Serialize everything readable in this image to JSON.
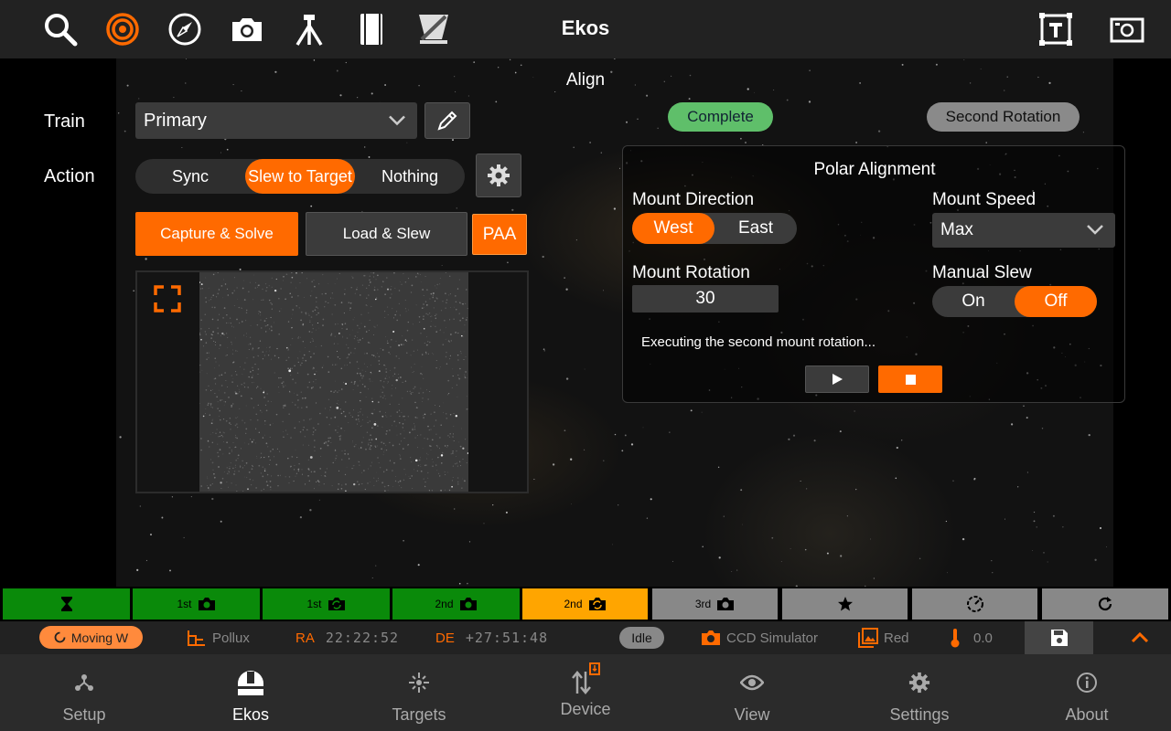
{
  "app": {
    "title": "Ekos"
  },
  "toolbar": {
    "icons": [
      "search-icon",
      "target-icon",
      "compass-icon",
      "camera-icon",
      "tripod-icon",
      "catalog-icon",
      "telescope-icon",
      "text-frame-icon",
      "screen-icon"
    ]
  },
  "align": {
    "section_title": "Align",
    "train_label": "Train",
    "train_value": "Primary",
    "action_label": "Action",
    "actions": [
      "Sync",
      "Slew to Target",
      "Nothing"
    ],
    "active_action": "Slew to Target",
    "capture_solve": "Capture & Solve",
    "load_slew": "Load & Slew",
    "paa": "PAA"
  },
  "polar": {
    "state_pill": "Complete",
    "stage_pill": "Second Rotation",
    "title": "Polar Alignment",
    "mount_direction_label": "Mount Direction",
    "directions": [
      "West",
      "East"
    ],
    "active_direction": "West",
    "mount_speed_label": "Mount Speed",
    "mount_speed_value": "Max",
    "mount_rotation_label": "Mount Rotation",
    "mount_rotation_value": "30",
    "manual_slew_label": "Manual Slew",
    "manual_slew_options": [
      "On",
      "Off"
    ],
    "manual_slew_active": "Off",
    "status_message": "Executing the second mount rotation..."
  },
  "steps": [
    {
      "label": "",
      "icon": "hourglass-icon",
      "state": "done"
    },
    {
      "label": "1st",
      "icon": "camera-icon",
      "state": "done"
    },
    {
      "label": "1st",
      "icon": "camera-rotate-icon",
      "state": "done"
    },
    {
      "label": "2nd",
      "icon": "camera-icon",
      "state": "done"
    },
    {
      "label": "2nd",
      "icon": "camera-rotate-icon",
      "state": "current"
    },
    {
      "label": "3rd",
      "icon": "camera-icon",
      "state": "todo"
    },
    {
      "label": "",
      "icon": "star-icon",
      "state": "todo"
    },
    {
      "label": "",
      "icon": "dial-icon",
      "state": "todo"
    },
    {
      "label": "",
      "icon": "refresh-icon",
      "state": "todo"
    }
  ],
  "status": {
    "mount_state": "Moving W",
    "target": "Pollux",
    "ra_label": "RA",
    "ra_value": "22:22:52",
    "de_label": "DE",
    "de_value": "+27:51:48",
    "idle": "Idle",
    "camera": "CCD Simulator",
    "filter": "Red",
    "temperature": "0.0"
  },
  "nav": {
    "items": [
      {
        "label": "Setup",
        "icon": "setup-icon"
      },
      {
        "label": "Ekos",
        "icon": "observatory-icon"
      },
      {
        "label": "Targets",
        "icon": "targets-icon"
      },
      {
        "label": "Device",
        "icon": "device-icon"
      },
      {
        "label": "View",
        "icon": "eye-icon"
      },
      {
        "label": "Settings",
        "icon": "gear-icon"
      },
      {
        "label": "About",
        "icon": "info-icon"
      }
    ],
    "active": "Ekos"
  },
  "colors": {
    "accent": "#ff6a00",
    "complete_green": "#5fbf6a",
    "step_done": "#0a8a0a",
    "step_current": "#ffa500",
    "step_todo": "#888888"
  }
}
